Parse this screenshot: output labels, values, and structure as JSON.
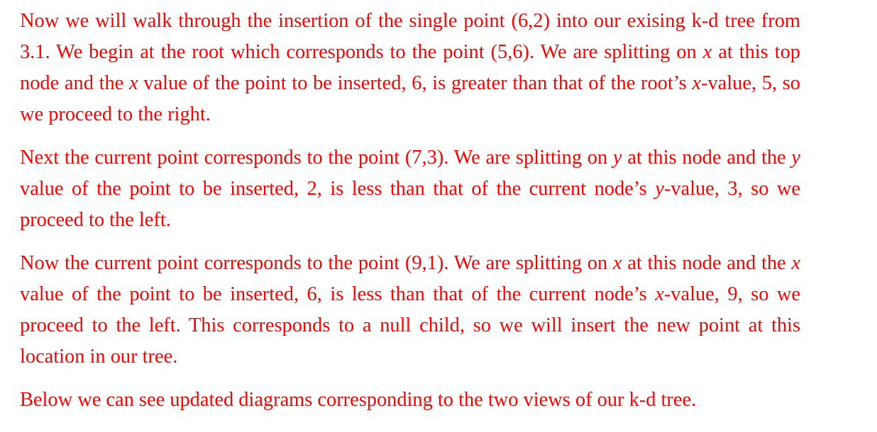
{
  "colors": {
    "text": "#ff0000",
    "background": "#ffffff"
  },
  "paragraphs": [
    {
      "runs": [
        {
          "t": "Now we will walk through the insertion of the single point (6,2) into our exising k-d tree from 3.1. We begin at the root which corresponds to the point (5,6). We are splitting on ",
          "m": false
        },
        {
          "t": "x",
          "m": true
        },
        {
          "t": " at this top node and the ",
          "m": false
        },
        {
          "t": "x",
          "m": true
        },
        {
          "t": " value of the point to be inserted, 6, is greater than that of the root’s ",
          "m": false
        },
        {
          "t": "x",
          "m": true
        },
        {
          "t": "-value, 5, so we proceed to the right.",
          "m": false
        }
      ]
    },
    {
      "runs": [
        {
          "t": "Next the current point corresponds to the point (7,3). We are splitting on ",
          "m": false
        },
        {
          "t": "y",
          "m": true
        },
        {
          "t": " at this node and the ",
          "m": false
        },
        {
          "t": "y",
          "m": true
        },
        {
          "t": " value of the point to be inserted, 2, is less than that of the current node’s ",
          "m": false
        },
        {
          "t": "y",
          "m": true
        },
        {
          "t": "-value, 3, so we proceed to the left.",
          "m": false
        }
      ]
    },
    {
      "runs": [
        {
          "t": "Now the current point corresponds to the point (9,1). We are splitting on ",
          "m": false
        },
        {
          "t": "x",
          "m": true
        },
        {
          "t": " at this node and the ",
          "m": false
        },
        {
          "t": "x",
          "m": true
        },
        {
          "t": " value of the point to be inserted, 6, is less than that of the current node’s ",
          "m": false
        },
        {
          "t": "x",
          "m": true
        },
        {
          "t": "-value, 9, so we proceed to the left. This corresponds to a null child, so we will insert the new point at this location in our tree.",
          "m": false
        }
      ]
    },
    {
      "runs": [
        {
          "t": "Below we can see updated diagrams corresponding to the two views of our k-d tree.",
          "m": false
        }
      ]
    }
  ]
}
